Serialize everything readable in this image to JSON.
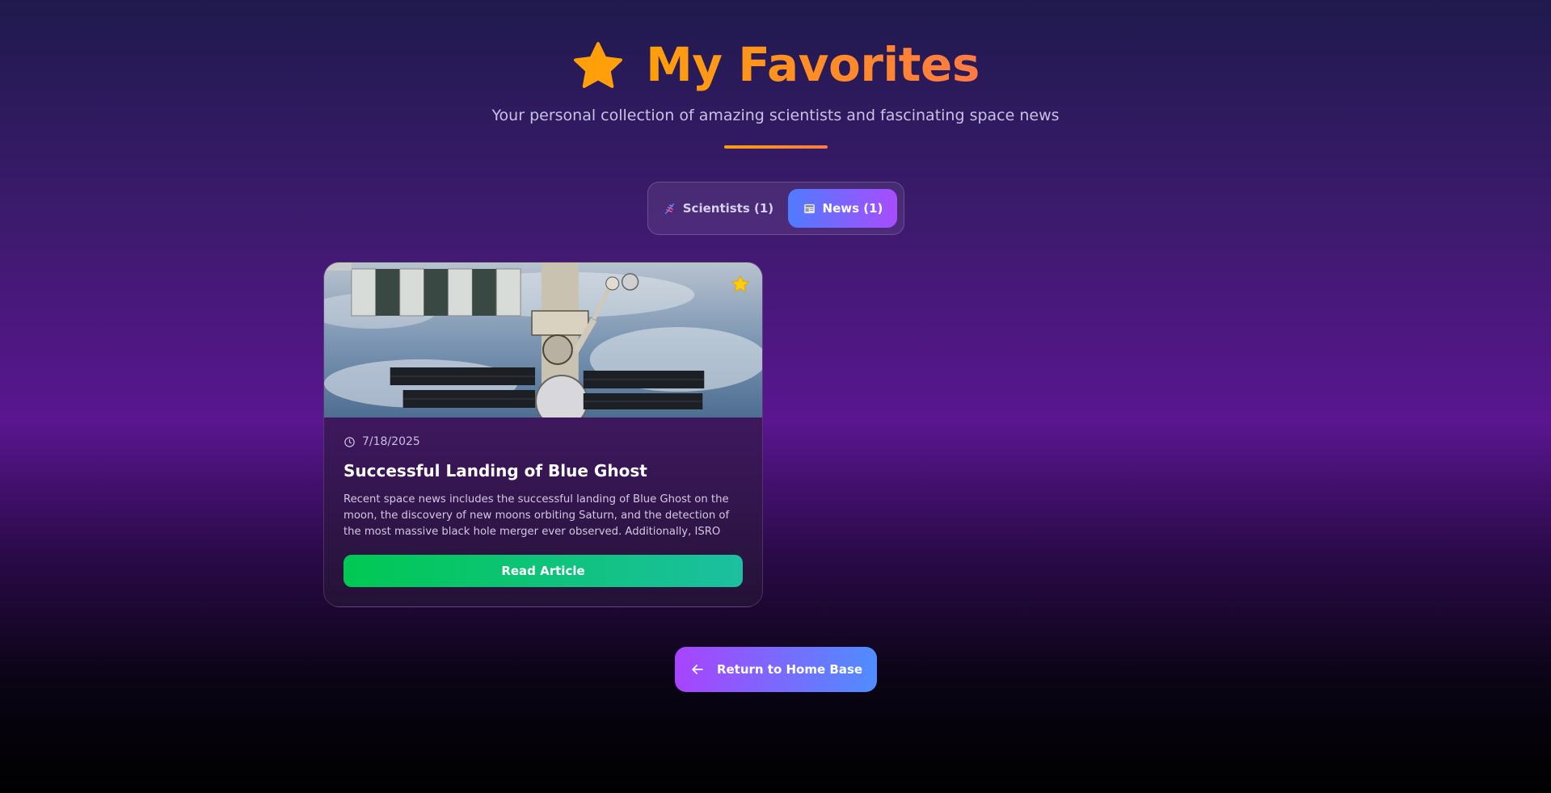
{
  "header": {
    "title": "My Favorites",
    "subtitle": "Your personal collection of amazing scientists and fascinating space news",
    "icon": "star-icon",
    "accent_color": "#ff9f0a"
  },
  "tabs": [
    {
      "label": "Scientists (1)",
      "icon": "dna-icon",
      "active": false
    },
    {
      "label": "News (1)",
      "icon": "newspaper-icon",
      "active": true
    }
  ],
  "news_cards": [
    {
      "date": "7/18/2025",
      "title": "Successful Landing of Blue Ghost",
      "excerpt": "Recent space news includes the successful landing of Blue Ghost on the moon, the discovery of new moons orbiting Saturn, and the detection of the most massive black hole merger ever observed. Additionally, ISRO celebrated its...",
      "button_label": "Read Article",
      "favorited": true
    }
  ],
  "footer": {
    "return_label": "Return to Home Base",
    "icon": "arrow-left-icon"
  }
}
